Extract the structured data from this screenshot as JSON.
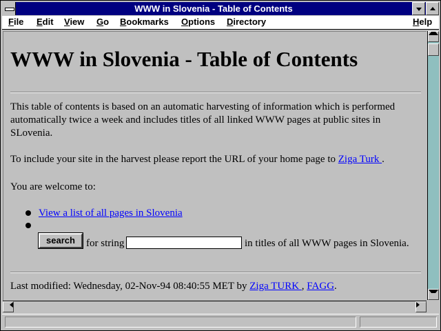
{
  "window": {
    "title": "WWW in Slovenia - Table of Contents"
  },
  "menu": {
    "items": [
      {
        "label_u": "F",
        "label_rest": "ile"
      },
      {
        "label_u": "E",
        "label_rest": "dit"
      },
      {
        "label_u": "V",
        "label_rest": "iew"
      },
      {
        "label_u": "G",
        "label_rest": "o"
      },
      {
        "label_u": "B",
        "label_rest": "ookmarks"
      },
      {
        "label_u": "O",
        "label_rest": "ptions"
      },
      {
        "label_u": "D",
        "label_rest": "irectory"
      },
      {
        "label_u": "H",
        "label_rest": "elp"
      }
    ]
  },
  "page": {
    "heading": "WWW in Slovenia - Table of Contents",
    "intro": "This table of contents is based on an automatic harvesting of information which is performed automatically twice a week and includes titles of all linked WWW pages at public sites in SLovenia.",
    "include_text": "To include your site in the harvest please report the URL of your home page to ",
    "include_link": "Ziga Turk ",
    "include_end": ".",
    "welcome": "You are welcome to:",
    "list_link": "View a list of all pages in Slovenia",
    "search_button": "search",
    "for_string": "for string",
    "search_value": "",
    "in_titles": "in titles of all WWW pages in Slovenia.",
    "modified_prefix": "Last modified: Wednesday, 02-Nov-94 08:40:55 MET by ",
    "modified_link1": "Ziga TURK ",
    "modified_sep": ", ",
    "modified_link2": "FAGG",
    "modified_end": "."
  },
  "icons": [
    "system-menu-icon",
    "minimize-icon",
    "maximize-icon",
    "scroll-up-icon",
    "scroll-down-icon",
    "scroll-left-icon",
    "scroll-right-icon"
  ],
  "colors": {
    "titlebar": "#000080",
    "link": "#0000ff",
    "background": "#c0c0c0",
    "scroll_track": "#8fbfbf"
  }
}
